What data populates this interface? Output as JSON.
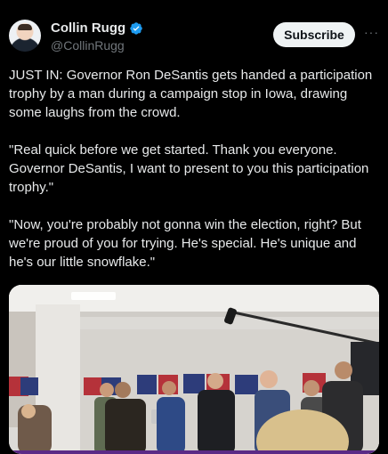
{
  "author": {
    "name": "Collin Rugg",
    "handle": "@CollinRugg",
    "verified": true,
    "verified_color": "#1d9bf0"
  },
  "actions": {
    "subscribe_label": "Subscribe",
    "more_label": "···"
  },
  "tweet": {
    "paragraphs": [
      "JUST IN: Governor Ron DeSantis gets handed a participation trophy by a man during a campaign stop in Iowa, drawing some laughs from the crowd.",
      "\"Real quick before we get started. Thank you everyone. Governor DeSantis, I want to present to you this participation trophy.\"",
      "\"Now, you're probably not gonna win the election, right? But we're proud of you for trying. He's special. He's unique and he's our little snowflake.\""
    ]
  },
  "media": {
    "type": "video",
    "description_icon": "video-thumbnail",
    "accent_colors": {
      "wall": "#e4e2de",
      "ceiling": "#f2f1ee",
      "signs": "#b5323a",
      "signs_blue": "#2d3c7a",
      "progress": "#5b2a86"
    }
  }
}
